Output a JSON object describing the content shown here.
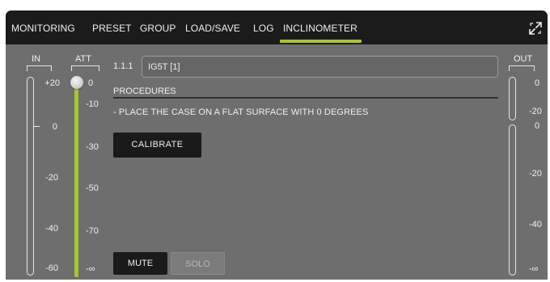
{
  "tabs": [
    {
      "label": "MONITORING",
      "active": false
    },
    {
      "label": "PRESET",
      "active": false
    },
    {
      "label": "GROUP",
      "active": false
    },
    {
      "label": "LOAD/SAVE",
      "active": false
    },
    {
      "label": "LOG",
      "active": false
    },
    {
      "label": "INCLINOMETER",
      "active": true
    }
  ],
  "colors": {
    "accent": "#a5c82a",
    "panel": "#6e6e6e",
    "tabbar": "#1b1b1b"
  },
  "icons": {
    "expand": "expand-arrows-icon",
    "fader": "fader-knob"
  },
  "input_meter": {
    "title": "IN",
    "scale": [
      "+20",
      "0",
      "-20",
      "-40",
      "-60"
    ]
  },
  "att_meter": {
    "title": "ATT",
    "scale": [
      "0",
      "-10",
      "-30",
      "-50",
      "-70",
      "-∞"
    ],
    "fader_value": "0"
  },
  "output_meter": {
    "title": "OUT",
    "upper_scale": [
      "0",
      "-20"
    ],
    "lower_scale": [
      "0",
      "-20",
      "-40",
      "-∞"
    ]
  },
  "channel": {
    "number": "1.1.1",
    "name": "IG5T [1]"
  },
  "procedures": {
    "heading": "PROCEDURES",
    "instruction": "- PLACE THE CASE ON A FLAT SURFACE WITH 0 DEGREES"
  },
  "buttons": {
    "calibrate": "CALIBRATE",
    "mute": "MUTE",
    "solo": "SOLO"
  }
}
